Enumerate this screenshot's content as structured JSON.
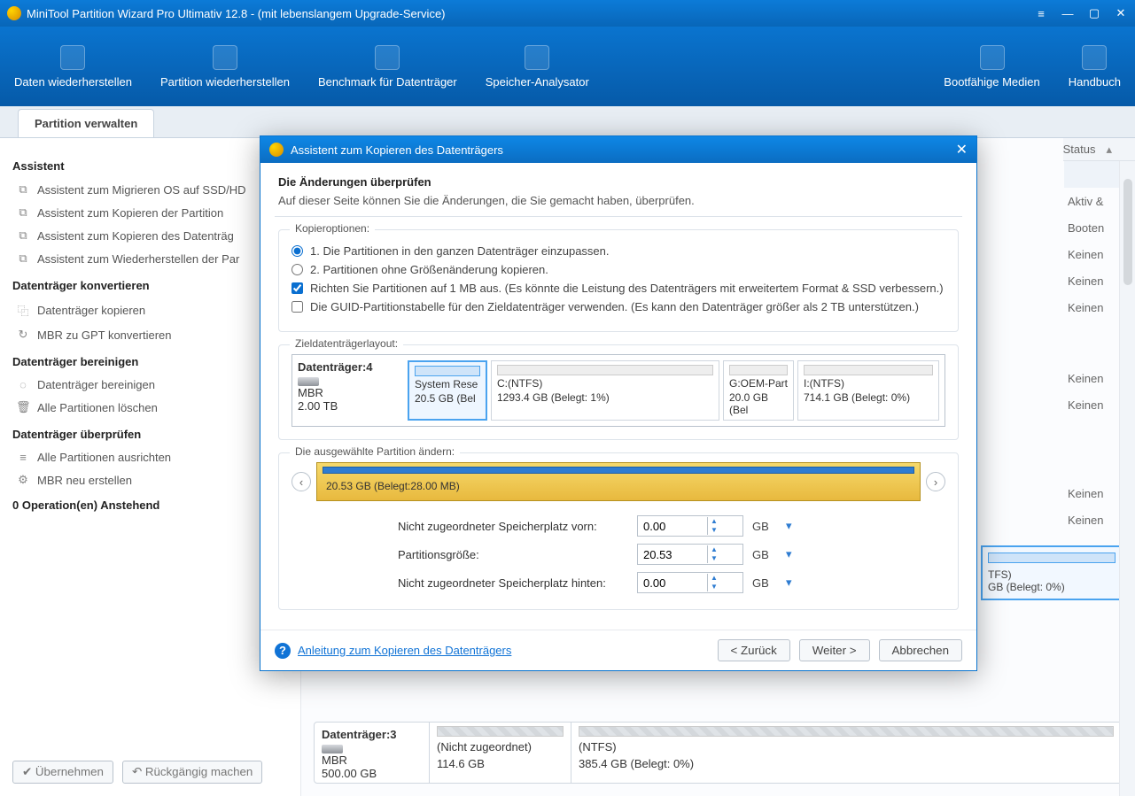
{
  "window": {
    "title": "MiniTool Partition Wizard Pro Ultimativ 12.8 - (mit lebenslangem Upgrade-Service)"
  },
  "ribbon": {
    "items": [
      "Daten wiederherstellen",
      "Partition wiederherstellen",
      "Benchmark für Datenträger",
      "Speicher-Analysator"
    ],
    "right": [
      "Bootfähige Medien",
      "Handbuch"
    ]
  },
  "tab": "Partition verwalten",
  "sidebar": {
    "grp_assistent": "Assistent",
    "assistent": [
      "Assistent zum Migrieren OS auf SSD/HD",
      "Assistent zum Kopieren der Partition",
      "Assistent zum Kopieren des Datenträg",
      "Assistent zum Wiederherstellen der Par"
    ],
    "grp_convert": "Datenträger konvertieren",
    "convert": [
      "Datenträger kopieren",
      "MBR zu GPT konvertieren"
    ],
    "grp_clean": "Datenträger bereinigen",
    "clean": [
      "Datenträger bereinigen",
      "Alle Partitionen löschen"
    ],
    "grp_check": "Datenträger überprüfen",
    "check": [
      "Alle Partitionen ausrichten",
      "MBR neu erstellen"
    ],
    "ops": "0 Operation(en) Anstehend",
    "btn_apply": "Übernehmen",
    "btn_undo": "Rückgängig machen"
  },
  "grid": {
    "status": "Status",
    "rows": [
      "Aktiv &",
      "Booten",
      "Keinen",
      "Keinen",
      "Keinen",
      "Keinen",
      "Keinen",
      "Keinen",
      "Keinen"
    ]
  },
  "disk3": {
    "name": "Datenträger:3",
    "type": "MBR",
    "size": "500.00 GB",
    "p1_name": "(Nicht zugeordnet)",
    "p1_size": "114.6 GB",
    "p2_name": "(NTFS)",
    "p2_size": "385.4 GB (Belegt: 0%)"
  },
  "blue_disk": {
    "name": "TFS)",
    "usage": "GB (Belegt: 0%)"
  },
  "dialog": {
    "title": "Assistent zum Kopieren des Datenträgers",
    "heading": "Die Änderungen überprüfen",
    "subheading": "Auf dieser Seite können Sie die Änderungen, die Sie gemacht haben, überprüfen.",
    "copy_legend": "Kopieroptionen:",
    "opt1": "1. Die Partitionen in den ganzen Datenträger einzupassen.",
    "opt2": "2. Partitionen ohne Größenänderung kopieren.",
    "chk1": "Richten Sie Partitionen auf 1 MB aus. (Es könnte die Leistung des Datenträgers mit erweitertem Format & SSD verbessern.)",
    "chk2": "Die GUID-Partitionstabelle für den Zieldatenträger verwenden. (Es kann den Datenträger größer als 2 TB unterstützen.)",
    "layout_legend": "Zieldatenträgerlayout:",
    "disk": {
      "name": "Datenträger:4",
      "type": "MBR",
      "size": "2.00 TB"
    },
    "parts": [
      {
        "name": "System Rese",
        "size": "20.5 GB (Bel"
      },
      {
        "name": "C:(NTFS)",
        "size": "1293.4 GB (Belegt: 1%)"
      },
      {
        "name": "G:OEM-Part",
        "size": "20.0 GB (Bel"
      },
      {
        "name": "I:(NTFS)",
        "size": "714.1 GB (Belegt: 0%)"
      }
    ],
    "edit_legend": "Die ausgewählte Partition ändern:",
    "slider_label": "20.53 GB (Belegt:28.00 MB)",
    "lbl_before": "Nicht zugeordneter Speicherplatz vorn:",
    "lbl_size": "Partitionsgröße:",
    "lbl_after": "Nicht zugeordneter Speicherplatz hinten:",
    "val_before": "0.00",
    "val_size": "20.53",
    "val_after": "0.00",
    "unit": "GB",
    "help": "Anleitung zum Kopieren des Datenträgers",
    "back": "< Zurück",
    "next": "Weiter >",
    "cancel": "Abbrechen"
  }
}
